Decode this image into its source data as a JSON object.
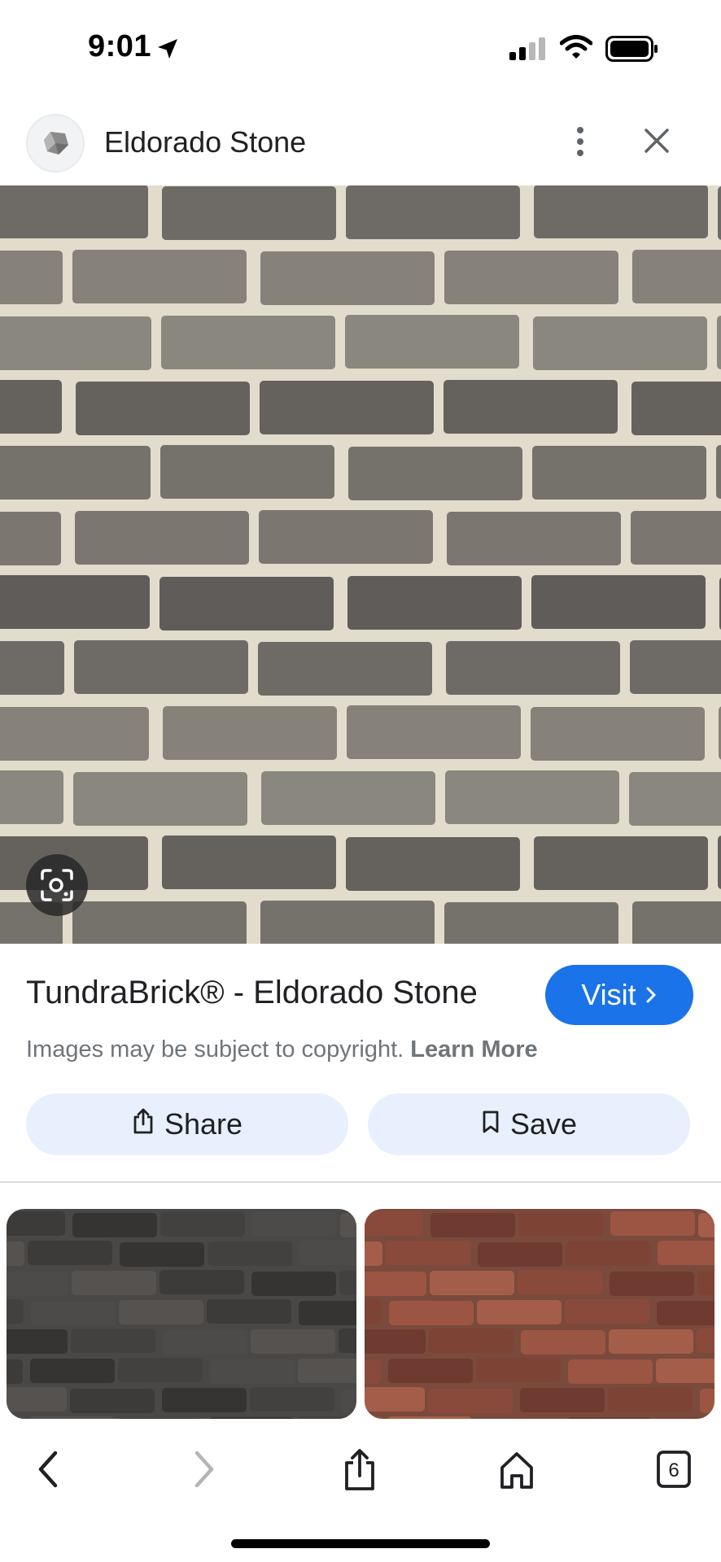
{
  "status_bar": {
    "time": "9:01",
    "icons": [
      "location-arrow-icon",
      "signal-icon",
      "wifi-icon",
      "battery-icon"
    ]
  },
  "header": {
    "site_name": "Eldorado Stone",
    "icons": [
      "site-logo-icon",
      "more-vert-icon",
      "close-icon"
    ]
  },
  "image": {
    "description_icon": "lens-icon"
  },
  "info": {
    "title": "TundraBrick® - Eldorado Stone",
    "visit_label": "Visit",
    "copyright_text": "Images may be subject to copyright.",
    "learn_more_label": "Learn More",
    "share_label": "Share",
    "save_label": "Save"
  },
  "toolbar": {
    "tab_count": "6",
    "icons": [
      "back-icon",
      "forward-icon",
      "share-icon",
      "home-icon",
      "tabs-icon"
    ]
  },
  "colors": {
    "accent": "#1a73e8",
    "chip_bg": "#e8f0fe",
    "text_primary": "#202124",
    "text_secondary": "#70757a"
  }
}
